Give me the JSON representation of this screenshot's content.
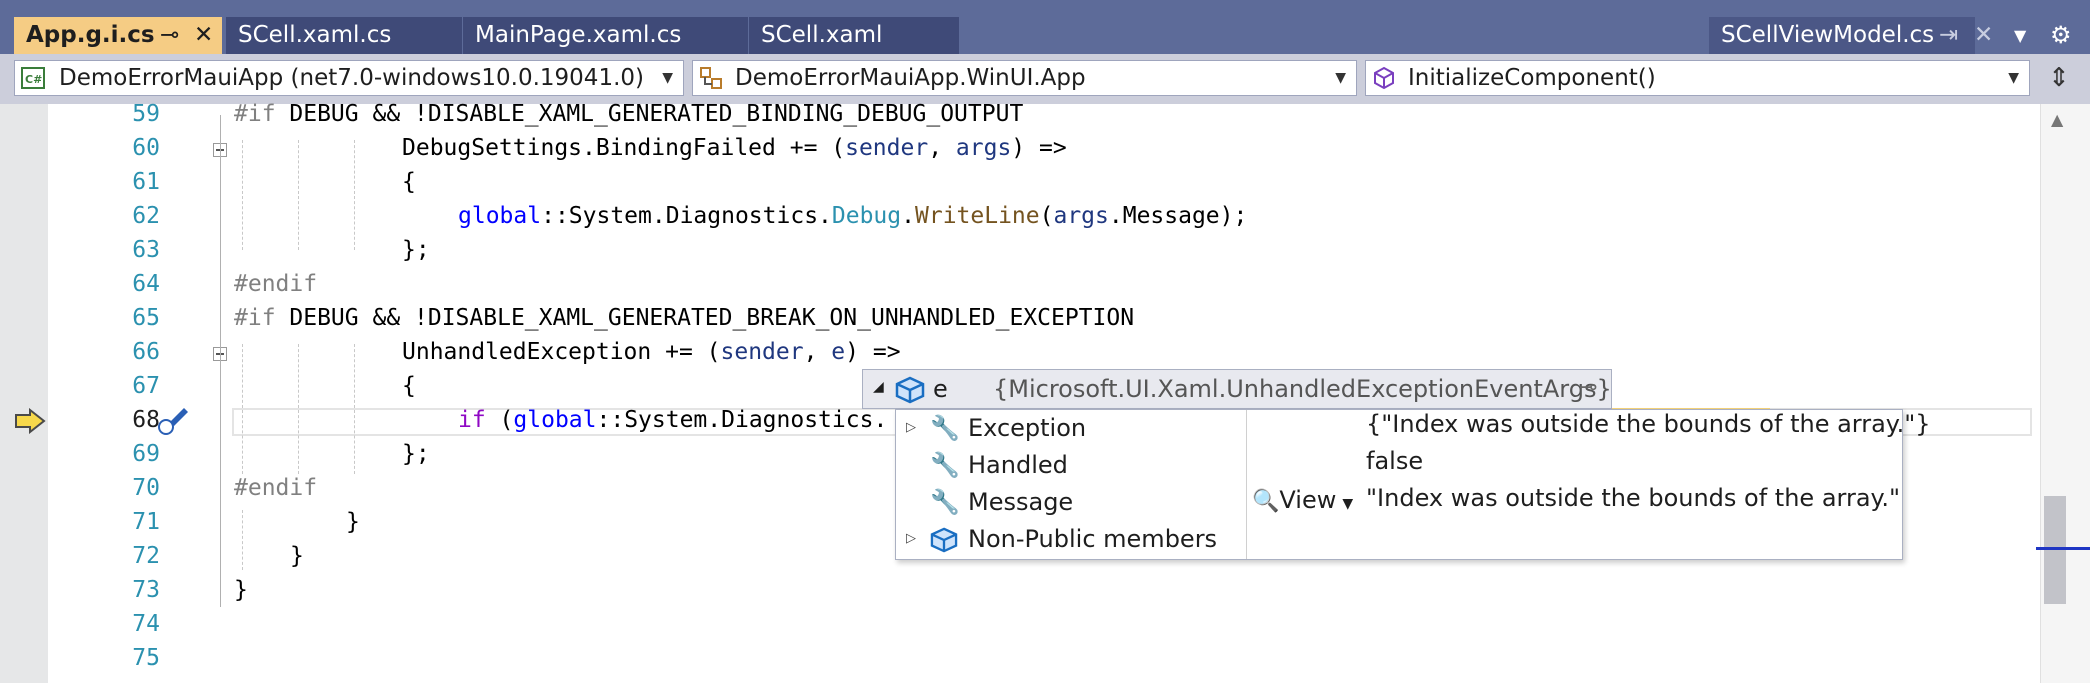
{
  "tabs": {
    "active": "App.g.i.cs",
    "items": [
      "SCell.xaml.cs",
      "MainPage.xaml.cs",
      "SCell.xaml"
    ],
    "preview": "SCellViewModel.cs"
  },
  "nav": {
    "project": "DemoErrorMauiApp (net7.0-windows10.0.19041.0)",
    "class": "DemoErrorMauiApp.WinUI.App",
    "member": "InitializeComponent()"
  },
  "lines": {
    "numbers": [
      "59",
      "60",
      "61",
      "62",
      "63",
      "64",
      "65",
      "66",
      "67",
      "68",
      "69",
      "70",
      "71",
      "72",
      "73",
      "74",
      "75"
    ]
  },
  "code": {
    "l59_a": "#if ",
    "l59_b": "DEBUG && !DISABLE_XAML_GENERATED_BINDING_DEBUG_OUTPUT",
    "l60_a": "DebugSettings.BindingFailed += (",
    "l60_b": "sender",
    "l60_c": ", ",
    "l60_d": "args",
    "l60_e": ") =>",
    "l61": "{",
    "l62_a": "global",
    "l62_b": "::System.Diagnostics.",
    "l62_c": "Debug",
    "l62_d": ".",
    "l62_e": "WriteLine",
    "l62_f": "(",
    "l62_g": "args",
    "l62_h": ".Message);",
    "l63": "};",
    "l64": "#endif",
    "l65_a": "#if ",
    "l65_b": "DEBUG && !DISABLE_XAML_GENERATED_BREAK_ON_UNHANDLED_EXCEPTION",
    "l66_a": "UnhandledException += (",
    "l66_b": "sender",
    "l66_c": ", ",
    "l66_d": "e",
    "l66_e": ") =>",
    "l67": "{",
    "l68_a": "if",
    "l68_b": " (",
    "l68_c": "global",
    "l68_d": "::System.Diagnostics.",
    "l69": "};",
    "l70": "#endif",
    "l71": "}",
    "l72": "}",
    "l73": "}"
  },
  "datatip": {
    "name": "e",
    "value": "{Microsoft.UI.Xaml.UnhandledExceptionEventArgs}",
    "rows": [
      {
        "name": "Exception",
        "value": "{\"Index was outside the bounds of the array.\"}"
      },
      {
        "name": "Handled",
        "value": "false"
      },
      {
        "name": "Message",
        "value": "\"Index was outside the bounds of the array.\""
      },
      {
        "name": "Non-Public members",
        "value": ""
      }
    ],
    "view_label": "View"
  },
  "colors": {
    "tabstrip": "#5d6b99",
    "active_tab": "#f5cc84",
    "line_number": "#2b91af",
    "keyword": "#0000ff",
    "control_keyword": "#8f08c4",
    "type": "#2b91af",
    "method": "#74531f",
    "parameter": "#1f377f",
    "preprocessor": "#808080"
  }
}
